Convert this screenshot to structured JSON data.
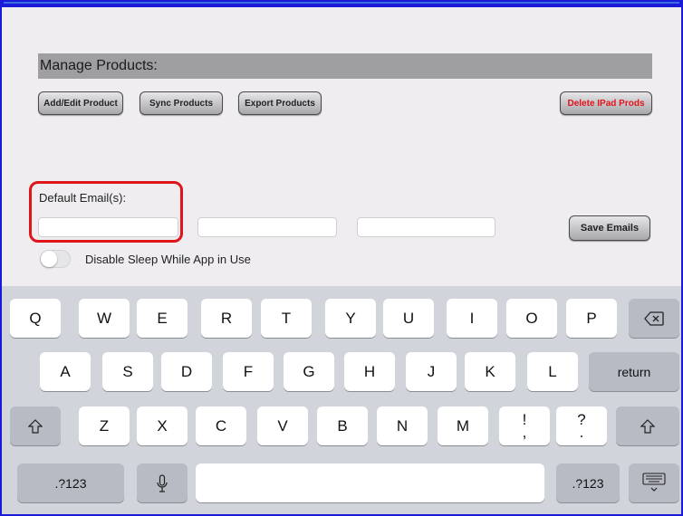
{
  "products": {
    "header": "Manage Products:",
    "buttons": {
      "add_edit": "Add/Edit Product",
      "sync": "Sync Products",
      "export": "Export Products",
      "delete": "Delete IPad Prods"
    }
  },
  "email": {
    "label": "Default Email(s):",
    "fields": [
      "",
      "",
      ""
    ],
    "save": "Save Emails"
  },
  "sleep_toggle": {
    "label": "Disable Sleep While App in Use",
    "on": false
  },
  "keyboard": {
    "row1": [
      "Q",
      "W",
      "E",
      "R",
      "T",
      "Y",
      "U",
      "I",
      "O",
      "P"
    ],
    "row2": [
      "A",
      "S",
      "D",
      "F",
      "G",
      "H",
      "J",
      "K",
      "L"
    ],
    "row3": [
      "Z",
      "X",
      "C",
      "V",
      "B",
      "N",
      "M"
    ],
    "return": "return",
    "numbers_left": ".?123",
    "numbers_right": ".?123",
    "exclaim": {
      "top": "!",
      "bottom": ","
    },
    "question": {
      "top": "?",
      "bottom": "."
    }
  },
  "colors": {
    "frame": "#1a1ad8",
    "highlight": "#e0141b",
    "delete_text": "#e0141b"
  }
}
